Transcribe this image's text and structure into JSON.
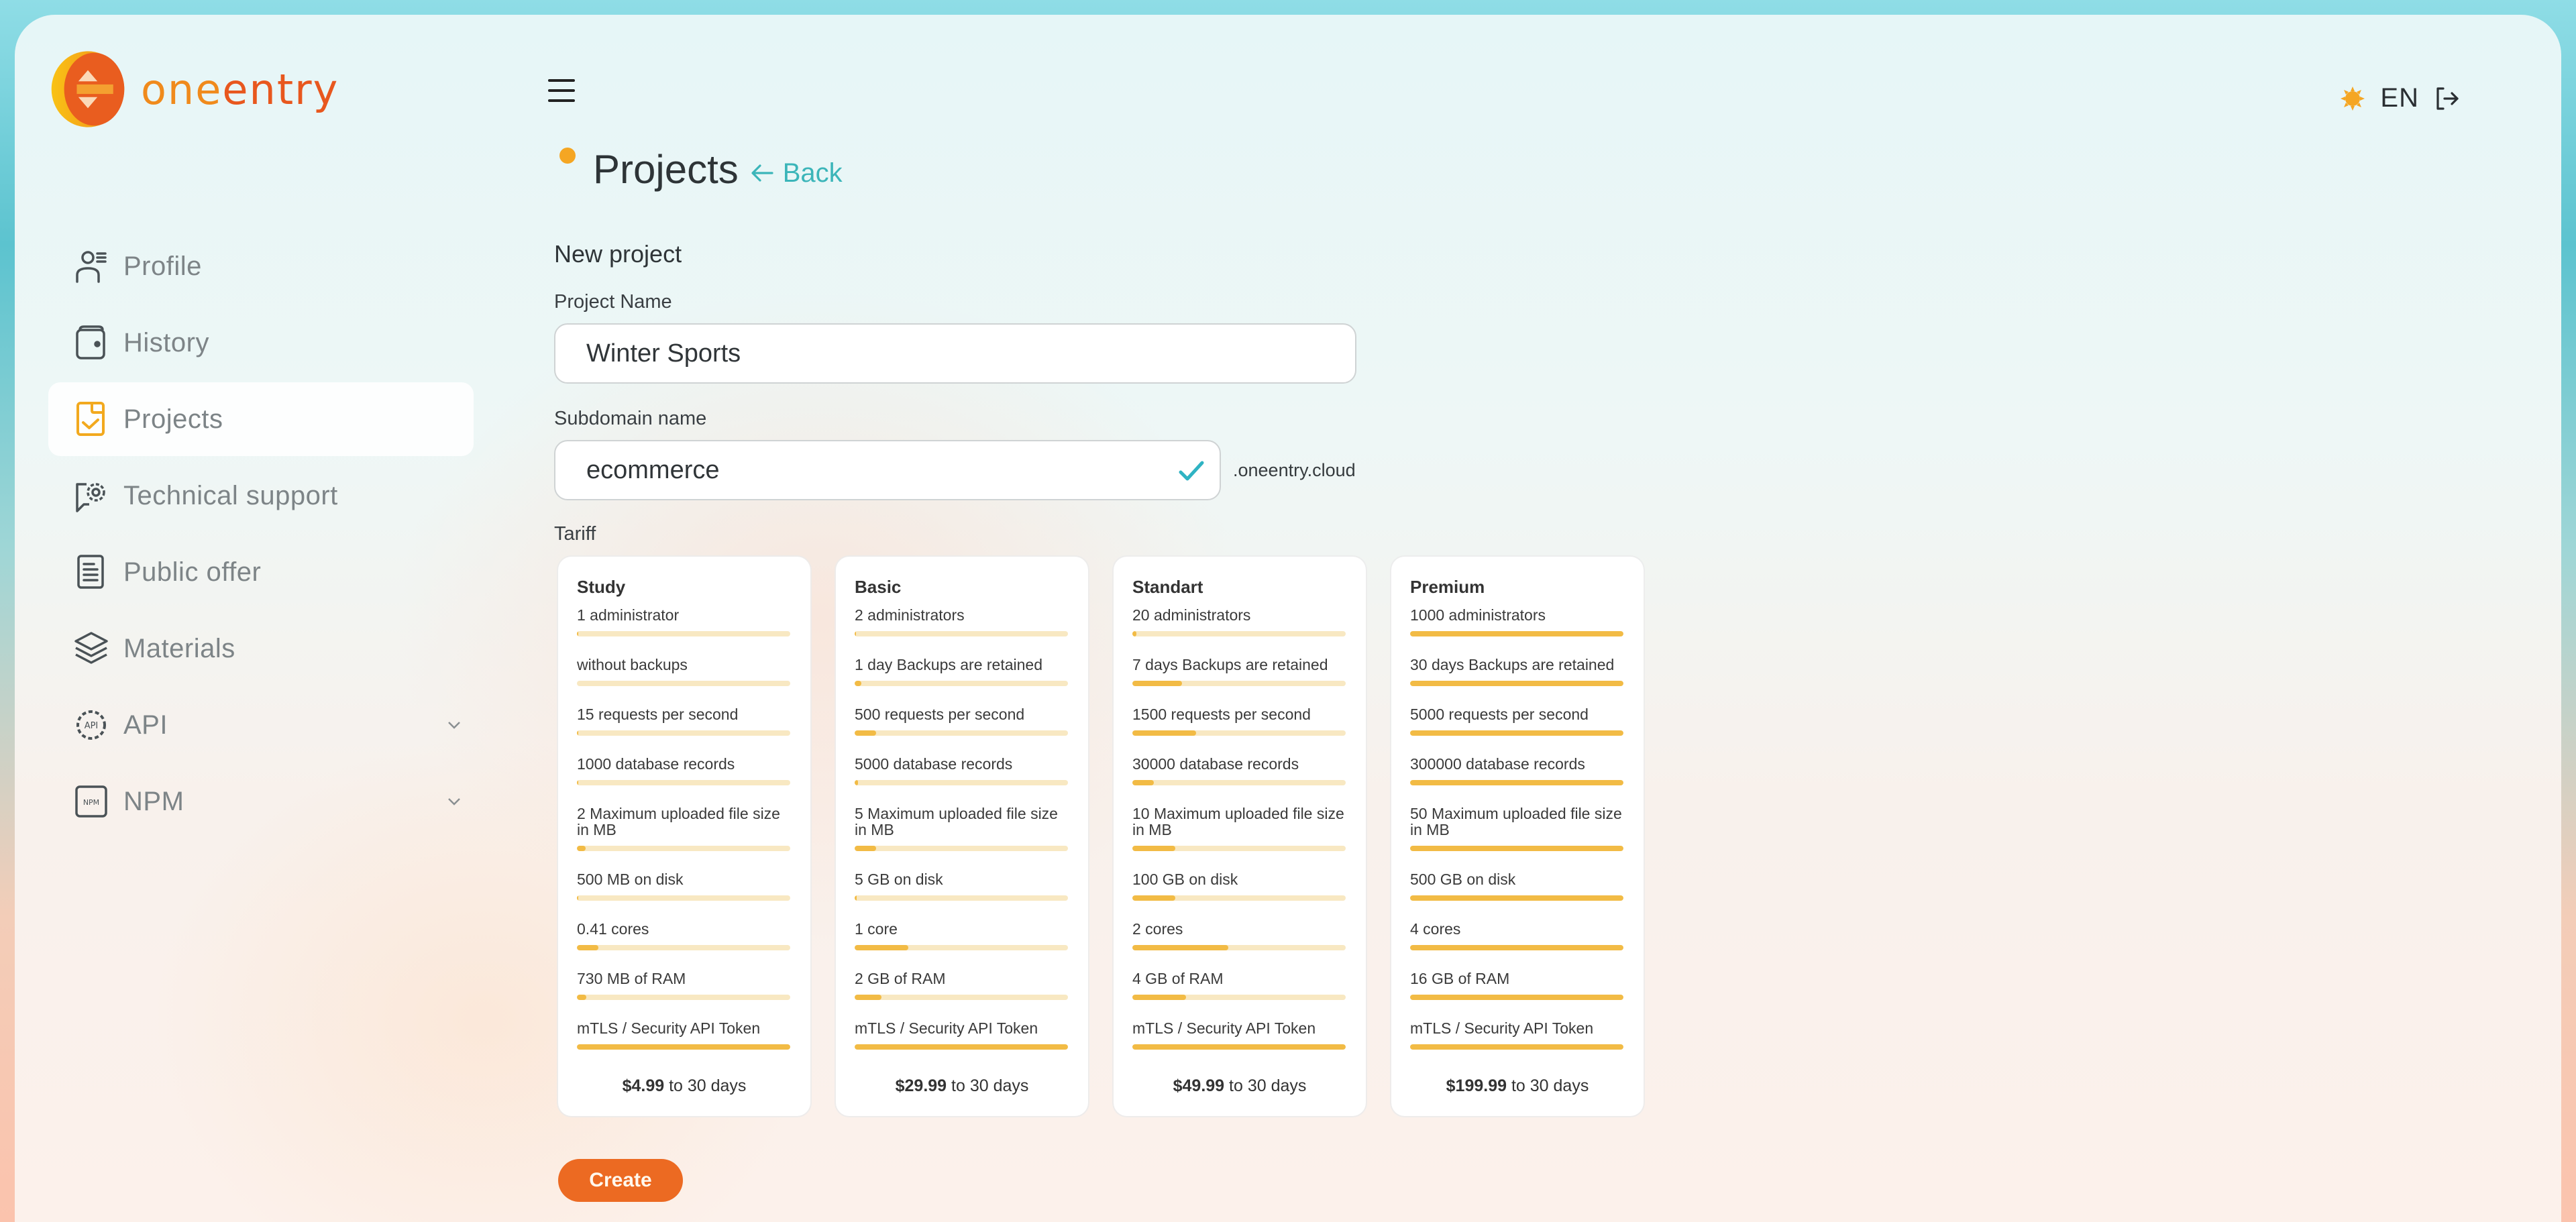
{
  "brand": {
    "name_part1": "one",
    "name_part2": "entry"
  },
  "header": {
    "language": "EN"
  },
  "sidebar": {
    "items": [
      {
        "label": "Profile",
        "icon": "profile-icon",
        "active": false,
        "expandable": false
      },
      {
        "label": "History",
        "icon": "wallet-icon",
        "active": false,
        "expandable": false
      },
      {
        "label": "Projects",
        "icon": "projects-icon",
        "active": true,
        "expandable": false
      },
      {
        "label": "Technical support",
        "icon": "support-gear-icon",
        "active": false,
        "expandable": false
      },
      {
        "label": "Public offer",
        "icon": "document-icon",
        "active": false,
        "expandable": false
      },
      {
        "label": "Materials",
        "icon": "layers-icon",
        "active": false,
        "expandable": false
      },
      {
        "label": "API",
        "icon": "api-gear-icon",
        "active": false,
        "expandable": true
      },
      {
        "label": "NPM",
        "icon": "npm-icon",
        "active": false,
        "expandable": true
      }
    ]
  },
  "page": {
    "title": "Projects",
    "back_label": "Back",
    "section_title": "New project"
  },
  "form": {
    "project_name_label": "Project Name",
    "project_name_value": "Winter Sports",
    "subdomain_label": "Subdomain name",
    "subdomain_value": "ecommerce",
    "subdomain_suffix": ".oneentry.cloud",
    "subdomain_valid": true,
    "tariff_label": "Tariff",
    "create_label": "Create"
  },
  "tariffs": [
    {
      "name": "Study",
      "price": "$4.99",
      "period": "to 30 days",
      "features": [
        {
          "text": "1 administrator",
          "fill": 0.001
        },
        {
          "text": "without backups",
          "fill": 0
        },
        {
          "text": "15 requests per second",
          "fill": 0.003
        },
        {
          "text": "1000 database records",
          "fill": 0.003
        },
        {
          "text": "2 Maximum uploaded file size in MB",
          "fill": 0.04
        },
        {
          "text": "500 MB on disk",
          "fill": 0.001
        },
        {
          "text": "0.41 cores",
          "fill": 0.1
        },
        {
          "text": "730 MB of RAM",
          "fill": 0.045
        },
        {
          "text": "mTLS / Security API Token",
          "fill": 1.0
        }
      ]
    },
    {
      "name": "Basic",
      "price": "$29.99",
      "period": "to 30 days",
      "features": [
        {
          "text": "2 administrators",
          "fill": 0.002
        },
        {
          "text": "1 day Backups are retained",
          "fill": 0.033
        },
        {
          "text": "500 requests per second",
          "fill": 0.1
        },
        {
          "text": "5000 database records",
          "fill": 0.017
        },
        {
          "text": "5 Maximum uploaded file size in MB",
          "fill": 0.1
        },
        {
          "text": "5 GB on disk",
          "fill": 0.01
        },
        {
          "text": "1 core",
          "fill": 0.25
        },
        {
          "text": "2 GB of RAM",
          "fill": 0.125
        },
        {
          "text": "mTLS / Security API Token",
          "fill": 1.0
        }
      ]
    },
    {
      "name": "Standart",
      "price": "$49.99",
      "period": "to 30 days",
      "features": [
        {
          "text": "20 administrators",
          "fill": 0.02
        },
        {
          "text": "7 days Backups are retained",
          "fill": 0.233
        },
        {
          "text": "1500 requests per second",
          "fill": 0.3
        },
        {
          "text": "30000 database records",
          "fill": 0.1
        },
        {
          "text": "10 Maximum uploaded file size in MB",
          "fill": 0.2
        },
        {
          "text": "100 GB on disk",
          "fill": 0.2
        },
        {
          "text": "2 cores",
          "fill": 0.45
        },
        {
          "text": "4 GB of RAM",
          "fill": 0.25
        },
        {
          "text": "mTLS / Security API Token",
          "fill": 1.0
        }
      ]
    },
    {
      "name": "Premium",
      "price": "$199.99",
      "period": "to 30 days",
      "features": [
        {
          "text": "1000 administrators",
          "fill": 1.0
        },
        {
          "text": "30 days Backups are retained",
          "fill": 1.0
        },
        {
          "text": "5000 requests per second",
          "fill": 1.0
        },
        {
          "text": "300000 database records",
          "fill": 1.0
        },
        {
          "text": "50 Maximum uploaded file size in MB",
          "fill": 1.0
        },
        {
          "text": "500 GB on disk",
          "fill": 1.0
        },
        {
          "text": "4 cores",
          "fill": 1.0
        },
        {
          "text": "16 GB of RAM",
          "fill": 1.0
        },
        {
          "text": "mTLS / Security API Token",
          "fill": 1.0
        }
      ]
    }
  ],
  "colors": {
    "accent_orange": "#ec6a22",
    "accent_yellow": "#f5a623",
    "link_teal": "#3bb5b9",
    "bar_fill": "#f2bb45",
    "bar_track": "#f8e8c2"
  }
}
